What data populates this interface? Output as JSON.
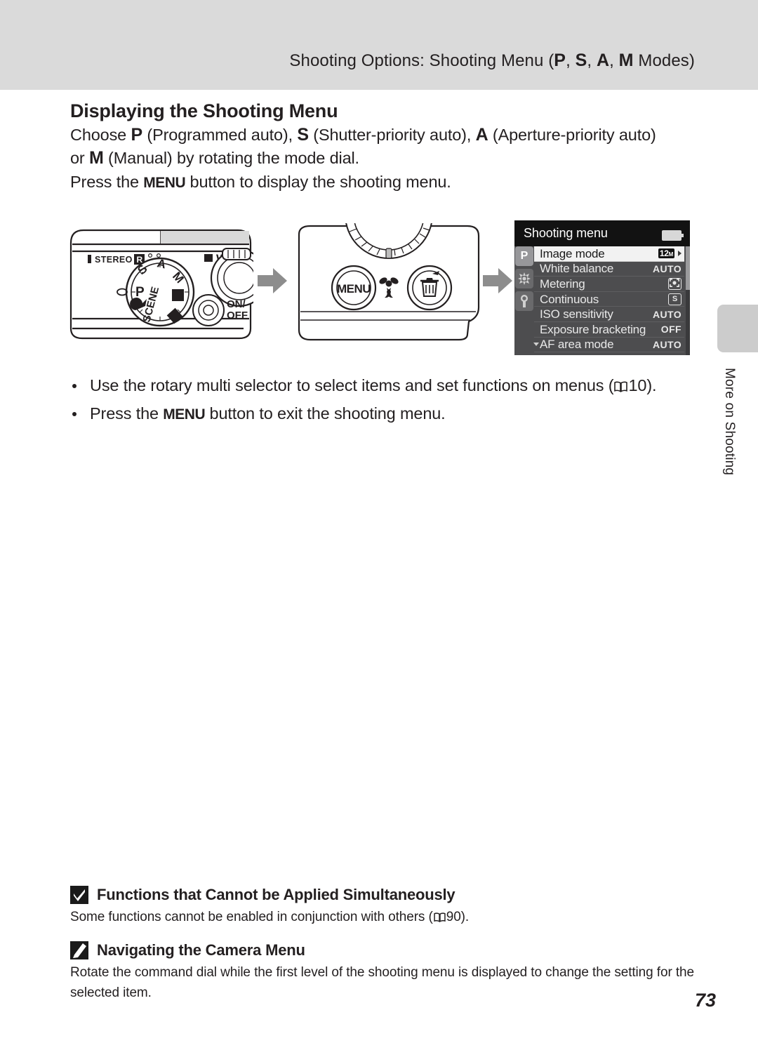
{
  "header": {
    "title_prefix": "Shooting Options: Shooting Menu (",
    "mode_p": "P",
    "sep1": ", ",
    "mode_s": "S",
    "sep2": ", ",
    "mode_a": "A",
    "sep3": ", ",
    "mode_m": "M",
    "title_suffix": " Modes)"
  },
  "section": {
    "heading": "Displaying the Shooting Menu",
    "line1_a": "Choose ",
    "line1_p": "P",
    "line1_b": " (Programmed auto), ",
    "line1_s": "S",
    "line1_c": " (Shutter-priority auto), ",
    "line1_aa": "A",
    "line1_d": " (Aperture-priority auto)",
    "line2_a": "or ",
    "line2_m": "M",
    "line2_b": " (Manual) by rotating the mode dial.",
    "line3_a": "Press the ",
    "line3_menu": "MENU",
    "line3_b": " button to display the shooting menu."
  },
  "bullets": [
    {
      "text_before": "Use the rotary multi selector to select items and set functions on menus (",
      "ref_icon": "book-icon",
      "ref_page": "10",
      "text_after": ")."
    },
    {
      "text_before": "Press the ",
      "key": "MENU",
      "text_after": " button to exit the shooting menu."
    }
  ],
  "side_tab": {
    "label": "More on Shooting"
  },
  "figure": {
    "camera_top": {
      "stereo_label": "STEREO",
      "channel_label": "R",
      "zoom_wide_label": "W",
      "power_label_top": "ON/",
      "power_label_bottom": "OFF",
      "dial_modes": [
        "S",
        "A",
        "M",
        "P",
        "SCENE"
      ]
    },
    "camera_back": {
      "menu_button_label": "MENU",
      "macro_icon": "flower-icon",
      "delete_icon": "trash-icon"
    },
    "arrow_icon": "arrow-right-icon"
  },
  "menu_screen": {
    "title": "Shooting menu",
    "battery_icon": "battery-icon",
    "side_tabs": [
      {
        "name": "shooting-tab",
        "glyph": "P",
        "active": true
      },
      {
        "name": "movie-tab",
        "glyph": "movie-icon",
        "active": false
      },
      {
        "name": "setup-tab",
        "glyph": "wrench-icon",
        "active": false
      }
    ],
    "items": [
      {
        "label": "Image mode",
        "value": "12M",
        "value_kind": "badge",
        "selected": true,
        "has_submenu_arrow": true
      },
      {
        "label": "White balance",
        "value": "AUTO",
        "value_kind": "text",
        "selected": false
      },
      {
        "label": "Metering",
        "value": "metering-icon",
        "value_kind": "icon",
        "selected": false
      },
      {
        "label": "Continuous",
        "value": "S",
        "value_kind": "boxed",
        "selected": false
      },
      {
        "label": "ISO sensitivity",
        "value": "AUTO",
        "value_kind": "text",
        "selected": false
      },
      {
        "label": "Exposure bracketing",
        "value": "OFF",
        "value_kind": "text",
        "selected": false
      },
      {
        "label": "AF area mode",
        "value": "AUTO",
        "value_kind": "text",
        "selected": false,
        "has_scroll_down": true
      }
    ]
  },
  "notes": [
    {
      "icon": "caution-check-icon",
      "title": "Functions that Cannot be Applied Simultaneously",
      "body_before": "Some functions cannot be enabled in conjunction with others (",
      "ref_icon": "book-icon",
      "ref_page": "90",
      "body_after": ")."
    },
    {
      "icon": "pencil-note-icon",
      "title": "Navigating the Camera Menu",
      "body": "Rotate the command dial while the first level of the shooting menu is displayed to change the setting for the selected item."
    }
  ],
  "page_number": "73"
}
